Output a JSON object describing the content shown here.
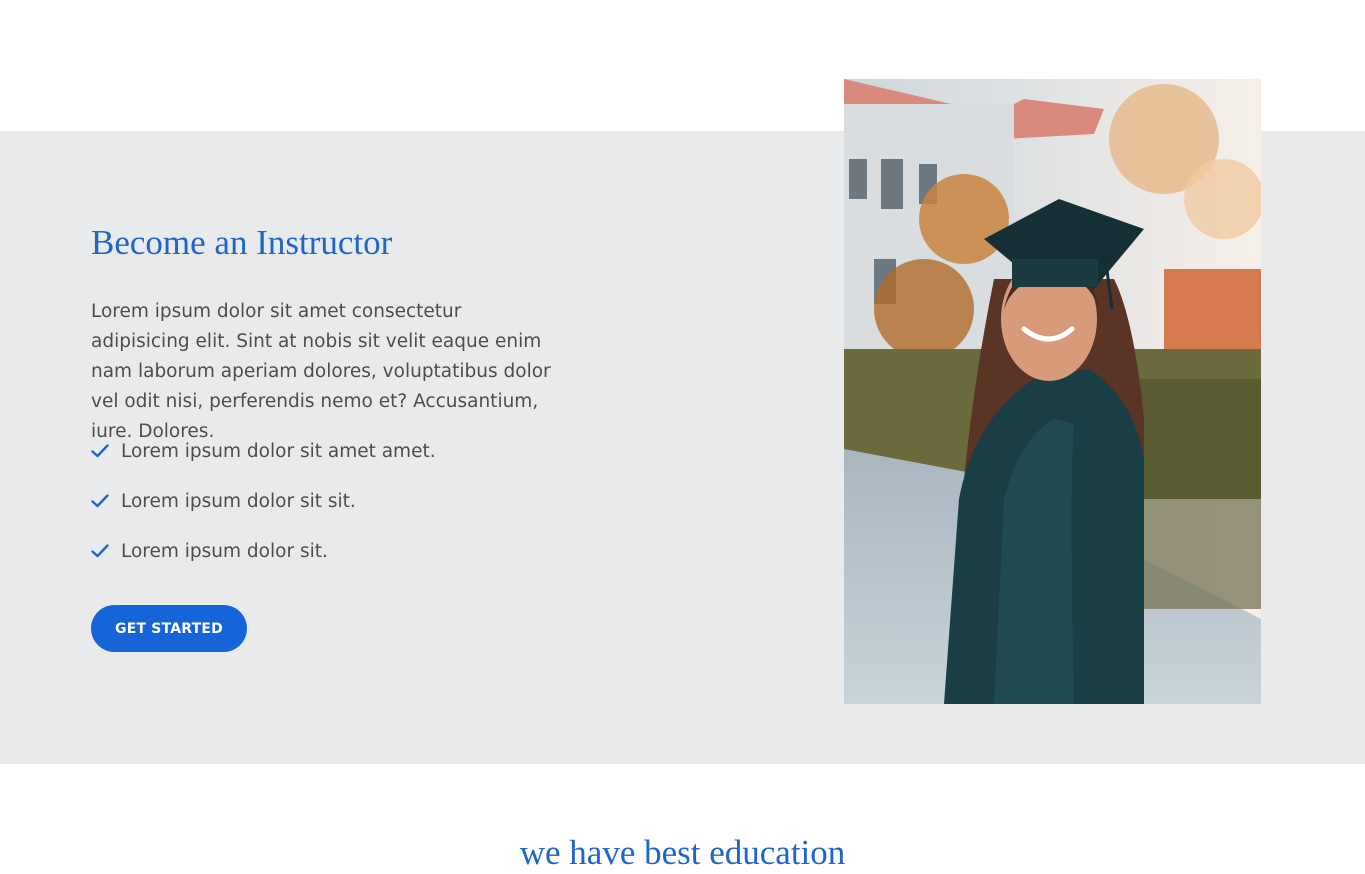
{
  "instructor": {
    "title": "Become an Instructor",
    "description": "Lorem ipsum dolor sit amet consectetur adipisicing elit. Sint at nobis sit velit eaque enim nam laborum aperiam dolores, voluptatibus dolor vel odit nisi, perferendis nemo et? Accusantium, iure. Dolores.",
    "checklist": [
      {
        "icon": "check-icon",
        "text": "Lorem ipsum dolor sit amet amet."
      },
      {
        "icon": "check-icon",
        "text": "Lorem ipsum dolor sit sit."
      },
      {
        "icon": "check-icon",
        "text": "Lorem ipsum dolor sit."
      }
    ],
    "cta_label": "GET STARTED",
    "image_alt": "Smiling graduate in dark green cap and gown outdoors"
  },
  "next_section": {
    "title": "we have best education"
  },
  "colors": {
    "accent": "#1e66c9",
    "button": "#1565d8",
    "band_background": "#e9eaec",
    "body_text": "#4d4d4d"
  }
}
